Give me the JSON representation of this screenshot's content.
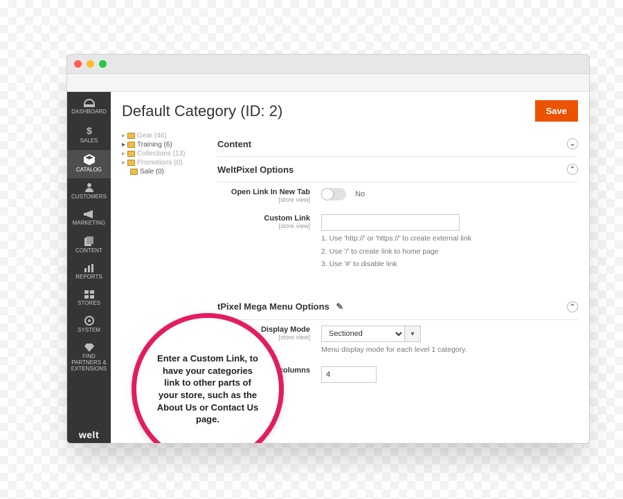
{
  "page_title": "Default Category (ID: 2)",
  "save_label": "Save",
  "nav": {
    "items": [
      {
        "label": "DASHBOARD",
        "icon": "dashboard"
      },
      {
        "label": "SALES",
        "icon": "dollar"
      },
      {
        "label": "CATALOG",
        "icon": "cube",
        "active": true
      },
      {
        "label": "CUSTOMERS",
        "icon": "person"
      },
      {
        "label": "MARKETING",
        "icon": "megaphone"
      },
      {
        "label": "CONTENT",
        "icon": "pages"
      },
      {
        "label": "REPORTS",
        "icon": "bars"
      },
      {
        "label": "STORES",
        "icon": "stores"
      },
      {
        "label": "SYSTEM",
        "icon": "gear"
      },
      {
        "label": "FIND PARTNERS & EXTENSIONS",
        "icon": "diamond"
      }
    ],
    "brand": "welt"
  },
  "tree": [
    {
      "label": "Gear (46)",
      "muted": true
    },
    {
      "label": "Training (6)"
    },
    {
      "label": "Collections (13)",
      "muted": true
    },
    {
      "label": "Promotions (0)",
      "muted": true
    },
    {
      "label": "Sale (0)",
      "indent": true
    }
  ],
  "sections": {
    "content": {
      "title": "Content",
      "expanded": false
    },
    "weltpixel": {
      "title": "WeltPixel Options",
      "expanded": true,
      "open_new_tab": {
        "label": "Open Link In New Tab",
        "scope": "[store view]",
        "value": "No"
      },
      "custom_link": {
        "label": "Custom Link",
        "scope": "[store view]",
        "value": "",
        "hints": [
          "1. Use 'http://' or 'https://' to create external link",
          "2. Use '/' to create link to home page",
          "3. Use '#' to disable link"
        ]
      }
    },
    "megamenu": {
      "title": "tPixel Mega Menu Options",
      "expanded": true,
      "display_mode": {
        "label": "Display Mode",
        "scope": "[store view]",
        "value": "Sectioned",
        "hint": "Menu display mode for each level 1 category."
      },
      "num_cols": {
        "label": "Number of columns",
        "value": "4"
      }
    }
  },
  "callout_text": "Enter a Custom Link, to have your categories link to other parts of your store, such as the About Us or Contact Us page."
}
